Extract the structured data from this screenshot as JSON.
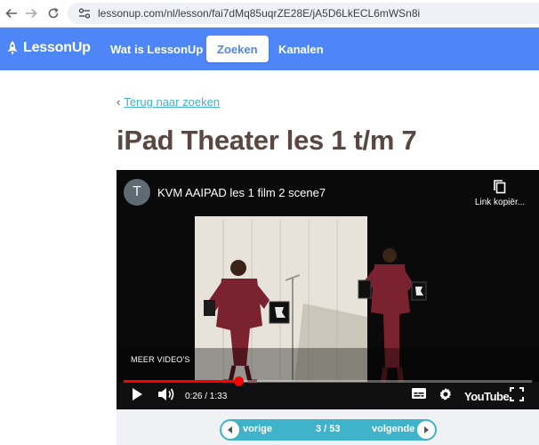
{
  "browser": {
    "url": "lessonup.com/nl/lesson/fai7dMq85uqrZE28E/jA5D6LkECL6mWSn8i"
  },
  "header": {
    "logo_text": "LessonUp",
    "nav": [
      {
        "label": "Wat is LessonUp"
      },
      {
        "label": "Zoeken"
      },
      {
        "label": "Kanalen"
      }
    ]
  },
  "main": {
    "back_link": "Terug naar zoeken",
    "title": "iPad Theater les 1 t/m 7"
  },
  "video": {
    "avatar_letter": "T",
    "title": "KVM AAIPAD les 1 film 2 scene7",
    "copy_link_label": "Link kopiër...",
    "more_videos": "MEER VIDEO'S",
    "time": "0:26 / 1:33",
    "progress_fraction": 0.28,
    "brand": "YouTube"
  },
  "pager": {
    "prev_label": "vorige",
    "position": "3 / 53",
    "next_label": "volgende"
  },
  "colors": {
    "brand_blue": "#4f86f7",
    "accent_teal": "#3fb3c9",
    "title_brown": "#5a4741",
    "progress_red": "#ff0000"
  }
}
